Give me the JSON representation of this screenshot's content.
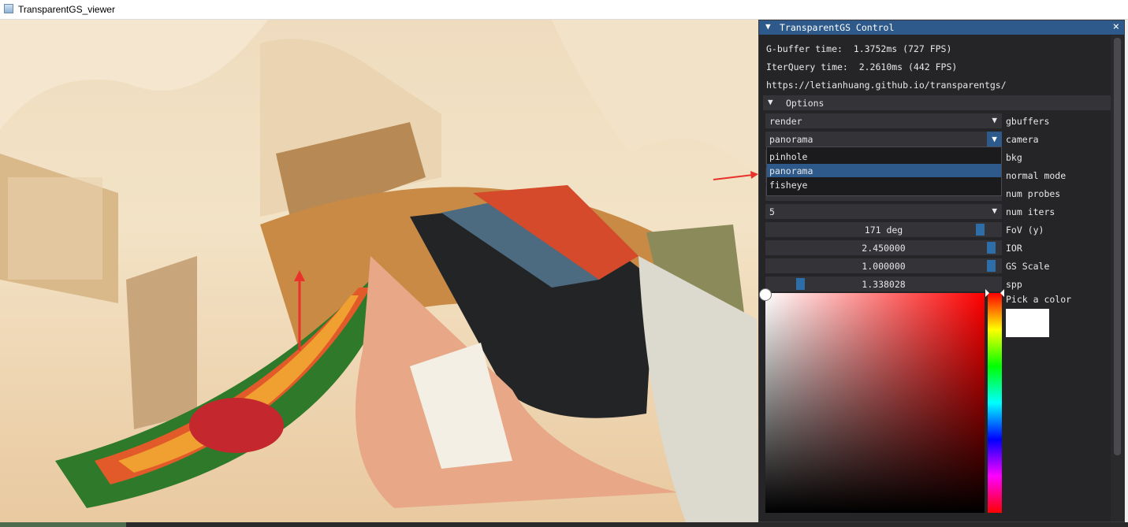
{
  "window": {
    "title": "TransparentGS_viewer"
  },
  "panel": {
    "title": "TransparentGS Control",
    "stats": [
      "G-buffer time:  1.3752ms (727 FPS)",
      "IterQuery time:  2.2610ms (442 FPS)",
      "https://letianhuang.github.io/transparentgs/"
    ],
    "options_header": "Options",
    "controls": [
      {
        "type": "combo",
        "value": "render",
        "label": "gbuffers"
      },
      {
        "type": "combo",
        "value": "panorama",
        "label": "camera",
        "open": true
      },
      {
        "type": "combo",
        "value": "",
        "label": "bkg"
      },
      {
        "type": "combo",
        "value": "",
        "label": "normal mode"
      },
      {
        "type": "combo",
        "value": "",
        "label": "num probes"
      },
      {
        "type": "combo",
        "value": "5",
        "label": "num iters"
      },
      {
        "type": "slider",
        "value": "171 deg",
        "label": "FoV (y)",
        "level": 0.93
      },
      {
        "type": "slider",
        "value": "2.450000",
        "label": "IOR",
        "level": 0.98
      },
      {
        "type": "slider",
        "value": "1.000000",
        "label": "GS Scale",
        "level": 0.98
      },
      {
        "type": "slider",
        "value": "1.338028",
        "label": "spp",
        "level": 0.13
      }
    ],
    "camera_options": [
      "pinhole",
      "panorama",
      "fisheye"
    ],
    "camera_selected": "panorama",
    "color_picker": {
      "label": "Pick a color",
      "value": "#ffffff"
    }
  },
  "colors": {
    "accent": "#2d5a8a",
    "panel_bg": "#252527",
    "widget_bg": "#333338",
    "annotation_arrow": "#e8322a"
  }
}
